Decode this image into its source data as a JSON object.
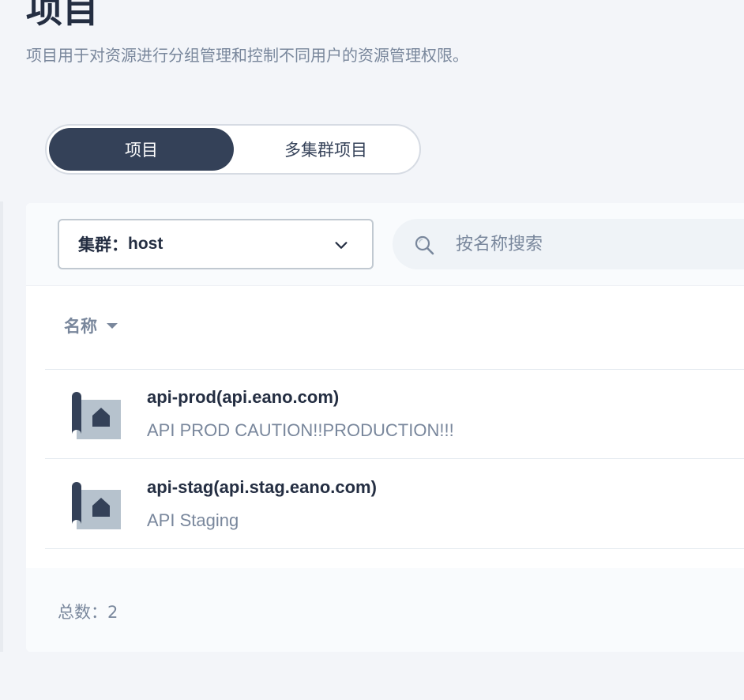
{
  "page": {
    "title": "项目",
    "description": "项目用于对资源进行分组管理和控制不同用户的资源管理权限。"
  },
  "tabs": [
    {
      "label": "项目",
      "active": true
    },
    {
      "label": "多集群项目",
      "active": false
    }
  ],
  "toolbar": {
    "cluster_label": "集群：",
    "cluster_value": "host",
    "search_placeholder": "按名称搜索",
    "search_value": ""
  },
  "table": {
    "column_name": "名称",
    "rows": [
      {
        "name": "api-prod(api.eano.com)",
        "description": "API PROD CAUTION!!PRODUCTION!!!"
      },
      {
        "name": "api-stag(api.stag.eano.com)",
        "description": "API Staging"
      }
    ]
  },
  "footer": {
    "total_label": "总数：",
    "total_count": "2"
  },
  "colors": {
    "primary_dark": "#344158",
    "text_dark": "#242e42",
    "text_muted": "#79879c",
    "icon_light": "#b6c2cd",
    "background": "#f3f5f9"
  },
  "icons": {
    "search": "search-icon",
    "dropdown": "chevron-down-icon",
    "sort": "caret-down-icon",
    "project": "project-icon"
  }
}
